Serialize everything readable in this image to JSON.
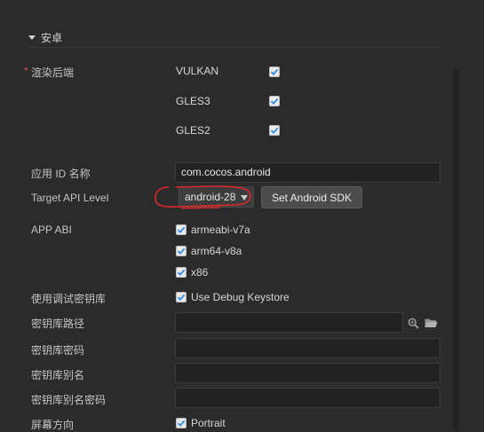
{
  "section": {
    "title": "安卓"
  },
  "render_backend": {
    "required_mark": "*",
    "label": "渲染后端",
    "options": [
      {
        "label": "VULKAN",
        "checked": true
      },
      {
        "label": "GLES3",
        "checked": true
      },
      {
        "label": "GLES2",
        "checked": true
      }
    ]
  },
  "app_id": {
    "label": "应用 ID 名称",
    "value": "com.cocos.android"
  },
  "target_api": {
    "label": "Target API Level",
    "selected": "android-28",
    "sdk_button": "Set Android SDK"
  },
  "app_abi": {
    "label": "APP ABI",
    "options": [
      {
        "label": "armeabi-v7a",
        "checked": true
      },
      {
        "label": "arm64-v8a",
        "checked": true
      },
      {
        "label": "x86",
        "checked": true
      }
    ]
  },
  "debug_keystore": {
    "label": "使用调试密钥库",
    "option": "Use Debug Keystore",
    "checked": true
  },
  "keystore_path": {
    "label": "密钥库路径",
    "value": ""
  },
  "keystore_password": {
    "label": "密钥库密码",
    "value": ""
  },
  "keystore_alias": {
    "label": "密钥库别名",
    "value": ""
  },
  "keystore_alias_password": {
    "label": "密钥库别名密码",
    "value": ""
  },
  "orientation": {
    "label": "屏幕方向",
    "option": "Portrait",
    "checked": true
  },
  "icons": {
    "search": "magnifier-icon",
    "folder": "folder-icon",
    "check": "checkmark-icon"
  },
  "colors": {
    "background": "#2b2b2b",
    "accent_check": "#2d8ce5",
    "annotation": "#e0282a",
    "required": "#e24b4b"
  }
}
